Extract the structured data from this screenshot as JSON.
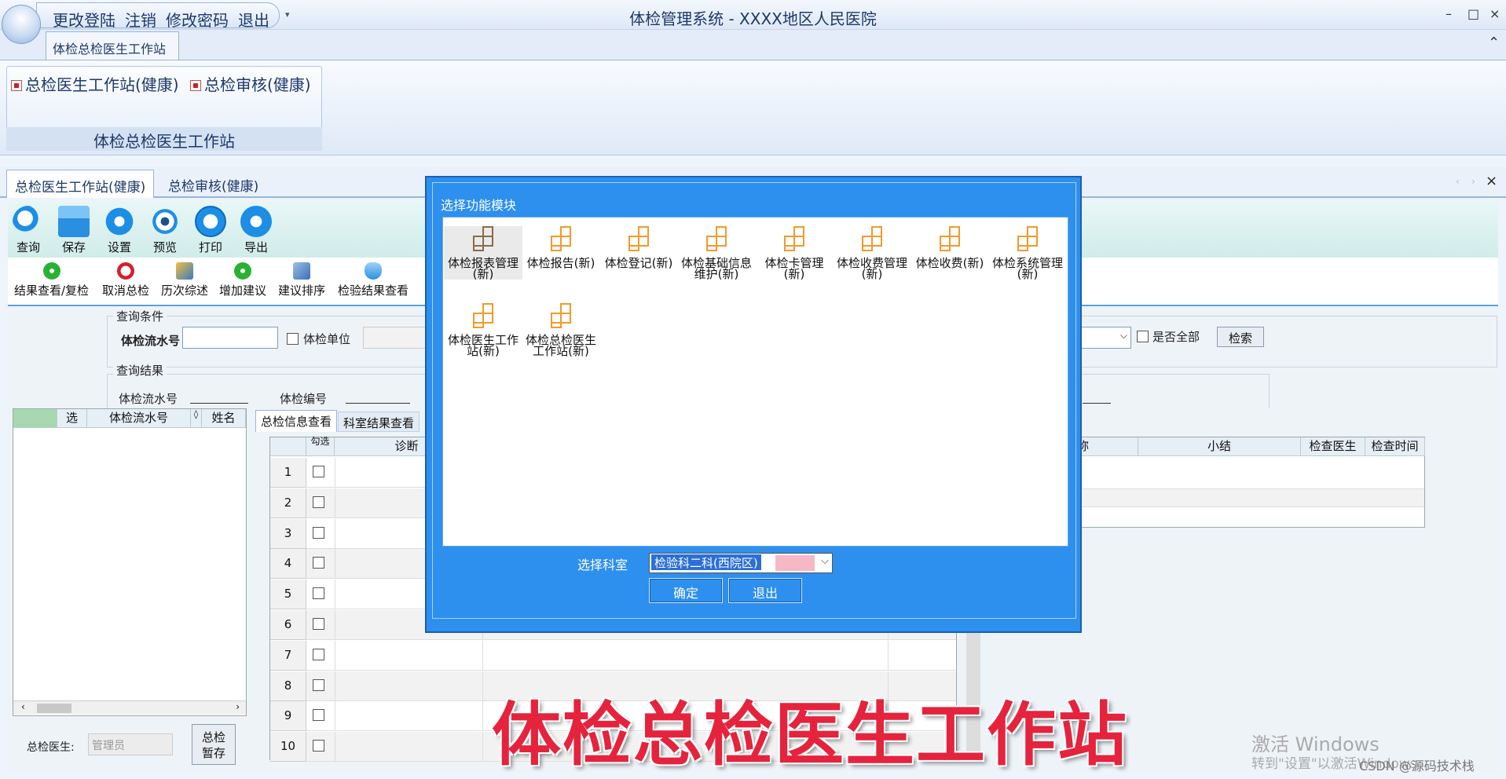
{
  "titlebar": {
    "menu": [
      "更改登陆",
      "注销",
      "修改密码",
      "退出"
    ],
    "app_title": "体检管理系统   -  XXXX地区人民医院",
    "win_min": "–",
    "win_max": "□",
    "win_close": "×"
  },
  "ribbon": {
    "tab": "体检总检医生工作站",
    "buttons": [
      "总检医生工作站(健康)",
      "总检审核(健康)"
    ],
    "group_label": "体检总检医生工作站",
    "collapse": "⌃"
  },
  "doc_tabs": [
    "总检医生工作站(健康)",
    "总检审核(健康)"
  ],
  "doc_tabs_close": "×",
  "toolbar": {
    "main_buttons": [
      {
        "label": "查询",
        "icon": "search-icon"
      },
      {
        "label": "保存",
        "icon": "save-icon"
      },
      {
        "label": "设置",
        "icon": "gear-icon"
      },
      {
        "label": "预览",
        "icon": "eye-icon"
      },
      {
        "label": "打印",
        "icon": "print-icon"
      },
      {
        "label": "导出",
        "icon": "export-icon"
      }
    ],
    "sub_buttons": [
      {
        "label": "结果查看/复检",
        "icon": "plus-green-icon"
      },
      {
        "label": "取消总检",
        "icon": "cancel-icon"
      },
      {
        "label": "历次综述",
        "icon": "history-icon"
      },
      {
        "label": "增加建议",
        "icon": "plus-green-icon"
      },
      {
        "label": "建议排序",
        "icon": "sort-icon"
      },
      {
        "label": "检验结果查看",
        "icon": "flask-icon"
      }
    ]
  },
  "query": {
    "section_label": "查询条件",
    "serial_label": "体检流水号",
    "serial_value": "",
    "unit_label": "体检单位",
    "all_label": "是否全部",
    "search_btn": "检索"
  },
  "result": {
    "section_label": "查询结果",
    "serial_label": "体检流水号",
    "exam_no_label": "体检编号"
  },
  "left_grid": {
    "columns": [
      "选",
      "体检流水号",
      "◊",
      "姓名"
    ]
  },
  "sub_tabs": [
    "总检信息查看",
    "科室结果查看"
  ],
  "center_grid": {
    "columns": [
      "勾选",
      "诊断"
    ],
    "rows": [
      "1",
      "2",
      "3",
      "4",
      "5",
      "6",
      "7",
      "8",
      "9",
      "10"
    ]
  },
  "right_grid": {
    "columns": [
      "称",
      "小结",
      "检查医生",
      "检查时间"
    ]
  },
  "doctor": {
    "label": "总检医生:",
    "value": "管理员",
    "temp_save_btn": "总检暂存"
  },
  "dialog": {
    "title": "选择功能模块",
    "modules": [
      "体检报表管理(新)",
      "体检报告(新)",
      "体检登记(新)",
      "体检基础信息维护(新)",
      "体检卡管理(新)",
      "体检收费管理(新)",
      "体检收费(新)",
      "体检系统管理(新)",
      "体检医生工作站(新)",
      "体检总检医生工作站(新)"
    ],
    "dept_label": "选择科室",
    "dept_value": "检验科二科(西院区)",
    "ok": "确定",
    "exit": "退出"
  },
  "overlay_title": "体检总检医生工作站",
  "watermark": {
    "line1": "激活 Windows",
    "line2": "转到\"设置\"以激活Windows。",
    "csdn": "CSDN @源码技术栈"
  },
  "colors": {
    "dialog_bg": "#2d8fee",
    "overlay_red": "#e5233d",
    "module_orange": "#f39a2b"
  }
}
